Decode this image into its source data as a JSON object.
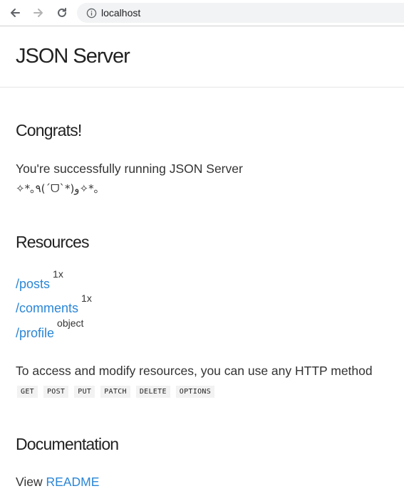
{
  "browser": {
    "url": "localhost"
  },
  "header": {
    "title": "JSON Server"
  },
  "congrats": {
    "title": "Congrats!",
    "line1": "You're successfully running JSON Server",
    "line2": "✧*｡٩(ˊᗜˋ*)و✧*｡"
  },
  "resources": {
    "title": "Resources",
    "items": [
      {
        "path": "/posts",
        "tag": "1x"
      },
      {
        "path": "/comments",
        "tag": "1x"
      },
      {
        "path": "/profile",
        "tag": "object"
      }
    ],
    "access_text": "To access and modify resources, you can use any HTTP method",
    "methods": [
      "GET",
      "POST",
      "PUT",
      "PATCH",
      "DELETE",
      "OPTIONS"
    ]
  },
  "documentation": {
    "title": "Documentation",
    "view_label": "View",
    "readme_label": "README"
  },
  "colors": {
    "link": "#2a86d6",
    "method_bg": "#f2f2f2"
  }
}
